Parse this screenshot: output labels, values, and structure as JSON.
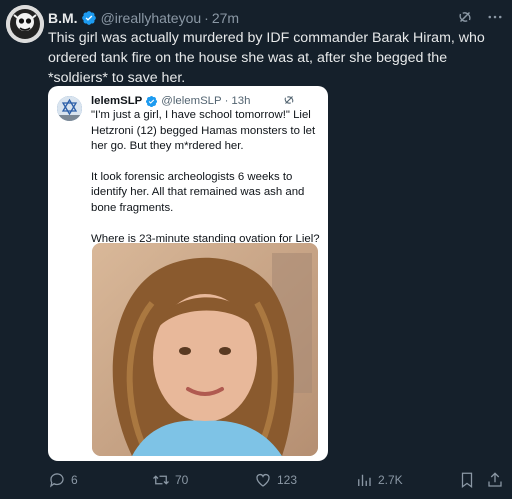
{
  "tweet": {
    "name": "B.M.",
    "handle": "@ireallyhateyou",
    "dot": "·",
    "time": "27m",
    "text": "This girl was actually murdered by IDF commander Barak Hiram, who ordered tank fire on the house she was at, after she begged the *soldiers* to save her."
  },
  "quote": {
    "name": "lelemSLP",
    "handle": "@lelemSLP",
    "dot": "·",
    "time": "13h",
    "paragraphs": [
      "\"I'm just a girl, I have school tomorrow!\" Liel Hetzroni (12) begged Hamas monsters to let her go. But they m*rdered her.",
      "It look forensic archeologists 6 weeks to identify her.  All that remained was ash and bone fragments.",
      "Where is 23-minute standing ovation for Liel?"
    ]
  },
  "actions": {
    "replies": "6",
    "reposts": "70",
    "likes": "123",
    "views": "2.7K"
  },
  "colors": {
    "background": "#15202b",
    "accent": "#1d9bf0",
    "muted": "#8b98a5"
  },
  "icons": [
    "verified-badge-icon",
    "grok-icon",
    "more-icon",
    "reply-icon",
    "repost-icon",
    "like-icon",
    "views-icon",
    "bookmark-icon",
    "share-icon"
  ]
}
